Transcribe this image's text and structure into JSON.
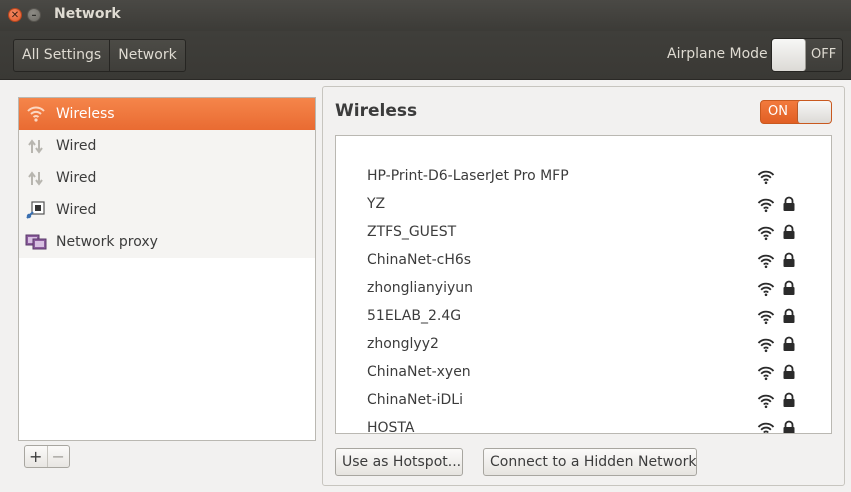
{
  "window": {
    "title": "Network"
  },
  "toolbar": {
    "breadcrumbs": [
      "All Settings",
      "Network"
    ],
    "airplane_label": "Airplane Mode",
    "airplane_state": "OFF"
  },
  "sidebar": {
    "items": [
      {
        "label": "Wireless",
        "icon": "wifi-icon",
        "selected": true
      },
      {
        "label": "Wired",
        "icon": "wired-icon",
        "selected": false
      },
      {
        "label": "Wired",
        "icon": "wired-icon",
        "selected": false
      },
      {
        "label": "Wired",
        "icon": "wired-network-icon",
        "selected": false
      },
      {
        "label": "Network proxy",
        "icon": "network-proxy-icon",
        "selected": false
      }
    ],
    "add_label": "+",
    "remove_label": "−"
  },
  "main": {
    "title": "Wireless",
    "wireless_state": "ON",
    "networks": [
      {
        "ssid": "HP-Print-D6-LaserJet Pro MFP",
        "secured": false
      },
      {
        "ssid": "YZ",
        "secured": true
      },
      {
        "ssid": "ZTFS_GUEST",
        "secured": true
      },
      {
        "ssid": "ChinaNet-cH6s",
        "secured": true
      },
      {
        "ssid": "zhonglianyiyun",
        "secured": true
      },
      {
        "ssid": "51ELAB_2.4G",
        "secured": true
      },
      {
        "ssid": "zhonglyy2",
        "secured": true
      },
      {
        "ssid": "ChinaNet-xyen",
        "secured": true
      },
      {
        "ssid": "ChinaNet-iDLi",
        "secured": true
      },
      {
        "ssid": "HOSTA",
        "secured": true
      }
    ],
    "hotspot_label": "Use as Hotspot...",
    "hidden_network_label": "Connect to a Hidden Network"
  },
  "colors": {
    "accent": "#e96b32",
    "titlebar": "#3c3b37",
    "panel": "#f2f1f0"
  }
}
